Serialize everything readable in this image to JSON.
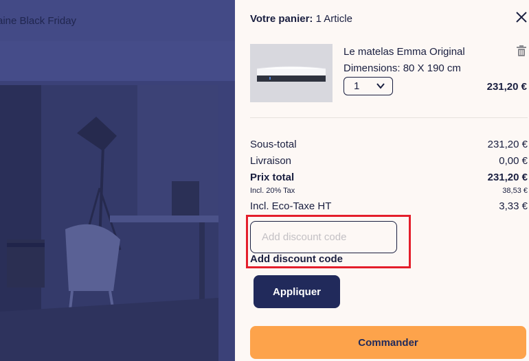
{
  "background_page": {
    "banner_text": "aine Black Friday"
  },
  "cart": {
    "title_label": "Votre panier:",
    "item_count": "1 Article",
    "item": {
      "name": "Le matelas Emma Original",
      "dimensions": "Dimensions: 80 X 190 cm",
      "quantity": "1",
      "price": "231,20 €"
    },
    "summary": {
      "subtotal_label": "Sous-total",
      "subtotal_value": "231,20 €",
      "shipping_label": "Livraison",
      "shipping_value": "0,00 €",
      "total_label": "Prix total",
      "total_value": "231,20 €",
      "tax_label": "Incl. 20% Tax",
      "tax_value": "38,53 €",
      "ecotax_label": "Incl. Eco-Taxe HT",
      "ecotax_value": "3,33 €"
    },
    "discount": {
      "placeholder": "Add discount code",
      "link_label": "Add discount code"
    },
    "apply_label": "Appliquer",
    "checkout_label": "Commander"
  },
  "colors": {
    "overlay": "#3b4178",
    "drawer_bg": "#fdf8f5",
    "navy": "#212a5b",
    "checkout_orange": "#fda34b",
    "highlight_red": "#e41e2b"
  },
  "icons": {
    "close": "close-icon",
    "trash": "trash-icon",
    "chevron": "chevron-down-icon"
  }
}
